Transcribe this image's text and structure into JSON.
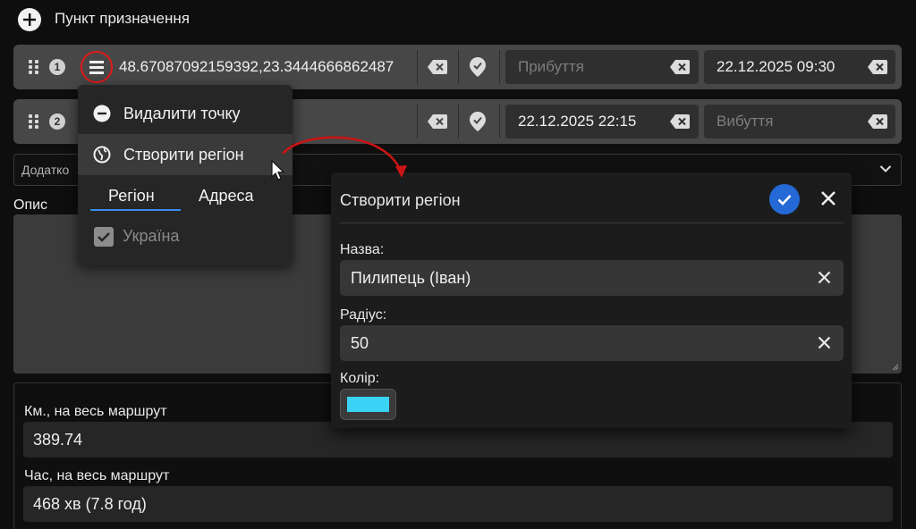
{
  "header": {
    "title": "Пункт призначення",
    "add_icon": "plus-circle-icon"
  },
  "waypoints": [
    {
      "number": "1",
      "coordinates": "48.67087092159392,23.3444666862487",
      "arrival_placeholder": "Прибуття",
      "departure_value": "22.12.2025 09:30"
    },
    {
      "number": "2",
      "arrival_value": "22.12.2025 22:15",
      "departure_placeholder": "Вибуття"
    }
  ],
  "additional": {
    "label": "Додатко"
  },
  "description": {
    "label": "Опис"
  },
  "summary": {
    "km_label": "Км., на весь маршрут",
    "km_value": "389.74",
    "time_label": "Час, на весь маршрут",
    "time_value": "468 хв (7.8 год)"
  },
  "context_menu": {
    "delete_label": "Видалити точку",
    "create_region_label": "Створити регіон",
    "tabs": [
      "Регіон",
      "Адреса"
    ],
    "active_tab": "Регіон",
    "checkbox_label": "Україна",
    "checkbox_checked": true
  },
  "dialog": {
    "title": "Створити регіон",
    "name_label": "Назва:",
    "name_value": "Пилипець (Іван)",
    "radius_label": "Радіус:",
    "radius_value": "50",
    "color_label": "Колір:",
    "color_value": "#3ad3f6"
  },
  "colors": {
    "accent": "#2469d6",
    "annotation": "#e01818",
    "swatch": "#3ad3f6"
  }
}
